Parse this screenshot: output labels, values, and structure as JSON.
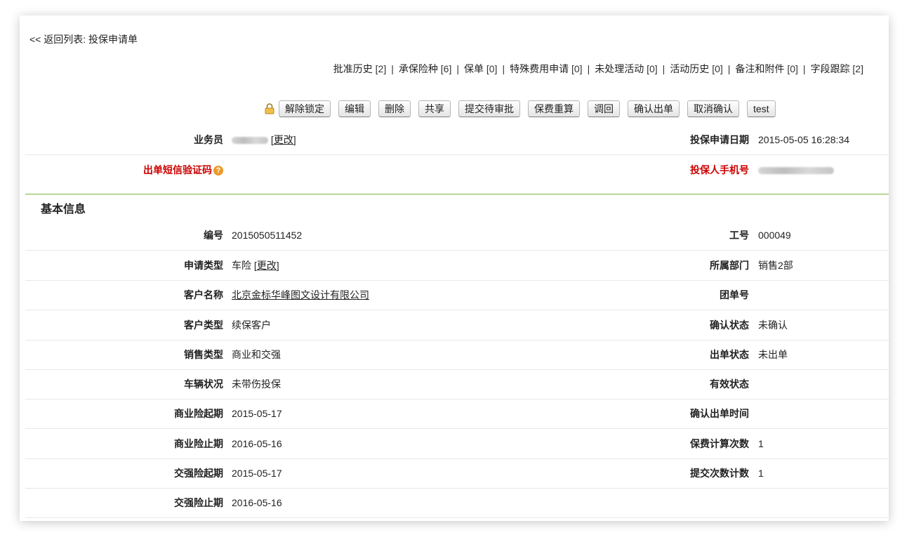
{
  "back_link": "<< 返回列表: 投保申请单",
  "related_lists": [
    {
      "label": "批准历史",
      "count": "[2]"
    },
    {
      "label": "承保险种",
      "count": "[6]"
    },
    {
      "label": "保单",
      "count": "[0]"
    },
    {
      "label": "特殊费用申请",
      "count": "[0]"
    },
    {
      "label": "未处理活动",
      "count": "[0]"
    },
    {
      "label": "活动历史",
      "count": "[0]"
    },
    {
      "label": "备注和附件",
      "count": "[0]"
    },
    {
      "label": "字段跟踪",
      "count": "[2]"
    }
  ],
  "related_separator": "|",
  "toolbar": {
    "buttons": [
      {
        "name": "unlock-button",
        "label": "解除锁定"
      },
      {
        "name": "edit-button",
        "label": "编辑"
      },
      {
        "name": "delete-button",
        "label": "删除"
      },
      {
        "name": "share-button",
        "label": "共享"
      },
      {
        "name": "submit-approval-button",
        "label": "提交待审批"
      },
      {
        "name": "recalc-premium-button",
        "label": "保费重算"
      },
      {
        "name": "recall-button",
        "label": "调回"
      },
      {
        "name": "confirm-issue-button",
        "label": "确认出单"
      },
      {
        "name": "cancel-confirm-button",
        "label": "取消确认"
      },
      {
        "name": "test-button",
        "label": "test"
      }
    ]
  },
  "header_fields": {
    "salesperson_label": "业务员",
    "change_link": "[更改]",
    "change_link_text": "更改",
    "apply_date_label": "投保申请日期",
    "apply_date_value": "2015-05-05 16:28:34",
    "sms_code_label": "出单短信验证码",
    "phone_label": "投保人手机号"
  },
  "section_title": "基本信息",
  "basic_info": {
    "number_label": "编号",
    "number_value": "2015050511452",
    "employee_id_label": "工号",
    "employee_id_value": "000049",
    "apply_type_label": "申请类型",
    "apply_type_value": "车险",
    "department_label": "所属部门",
    "department_value": "销售2部",
    "customer_name_label": "客户名称",
    "customer_name_value": "北京金标华峰图文设计有限公司",
    "group_no_label": "团单号",
    "group_no_value": "",
    "customer_type_label": "客户类型",
    "customer_type_value": "续保客户",
    "confirm_status_label": "确认状态",
    "confirm_status_value": "未确认",
    "sales_type_label": "销售类型",
    "sales_type_value": "商业和交强",
    "issue_status_label": "出单状态",
    "issue_status_value": "未出单",
    "vehicle_status_label": "车辆状况",
    "vehicle_status_value": "未带伤投保",
    "valid_status_label": "有效状态",
    "valid_status_value": "",
    "commercial_start_label": "商业险起期",
    "commercial_start_value": "2015-05-17",
    "confirm_issue_time_label": "确认出单时间",
    "confirm_issue_time_value": "",
    "commercial_end_label": "商业险止期",
    "commercial_end_value": "2016-05-16",
    "premium_calc_count_label": "保费计算次数",
    "premium_calc_count_value": "1",
    "compulsory_start_label": "交强险起期",
    "compulsory_start_value": "2015-05-17",
    "submit_count_label": "提交次数计数",
    "submit_count_value": "1",
    "compulsory_end_label": "交强险止期",
    "compulsory_end_value": "2016-05-16"
  }
}
